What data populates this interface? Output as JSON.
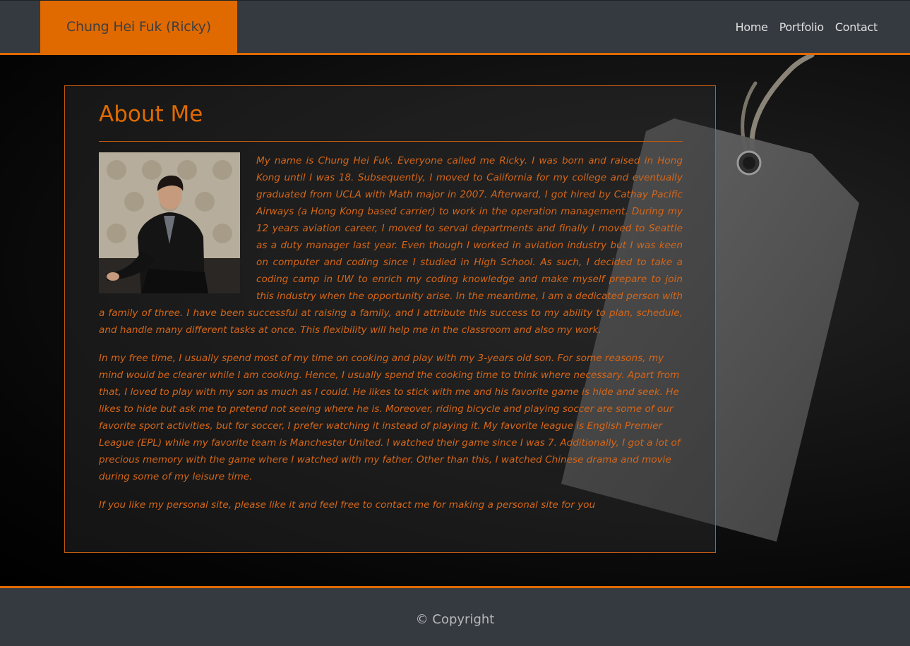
{
  "header": {
    "brand": "Chung Hei Fuk (Ricky)",
    "nav": [
      "Home",
      "Portfolio",
      "Contact"
    ]
  },
  "about": {
    "title": "About Me",
    "paragraphs": [
      "My name is Chung Hei Fuk. Everyone called me Ricky. I was born and raised in Hong Kong until I was 18. Subsequently, I moved to California for my college and eventually graduated from UCLA with Math major in 2007. Afterward, I got hired by Cathay Pacific Airways (a Hong Kong based carrier) to work in the operation management. During my 12 years aviation career, I moved to serval departments and finally I moved to Seattle as a duty manager last year. Even though I worked in aviation industry but I was keen on computer and coding since I studied in High School. As such, I decided to take a coding camp in UW to enrich my coding knowledge and make myself prepare to join this industry when the opportunity arise. In the meantime, I am a dedicated person with a family of three. I have been successful at raising a family, and I attribute this success to my ability to plan, schedule, and handle many different tasks at once. This flexibility will help me in the classroom and also my work.",
      "In my free time, I usually spend most of my time on cooking and play with my 3-years old son. For some reasons, my mind would be clearer while I am cooking. Hence, I usually spend the cooking time to think where necessary. Apart from that, I loved to play with my son as much as I could. He likes to stick with me and his favorite game is hide and seek. He likes to hide but ask me to pretend not seeing where he is. Moreover, riding bicycle and playing soccer are some of our favorite sport activities, but for soccer, I prefer watching it instead of playing it. My favorite league is English Premier League (EPL) while my favorite team is Manchester United. I watched their game since I was 7. Additionally, I got a lot of precious memory with the game where I watched with my father. Other than this, I watched Chinese drama and movie during some of my leisure time.",
      "If you like my personal site, please like it and feel free to contact me for making a personal site for you"
    ]
  },
  "footer": {
    "copyright": "© Copyright"
  },
  "colors": {
    "accent": "#e06a00",
    "bar": "#343a40",
    "text": "#d4661a"
  },
  "icons": {
    "portrait": "profile-photo"
  }
}
